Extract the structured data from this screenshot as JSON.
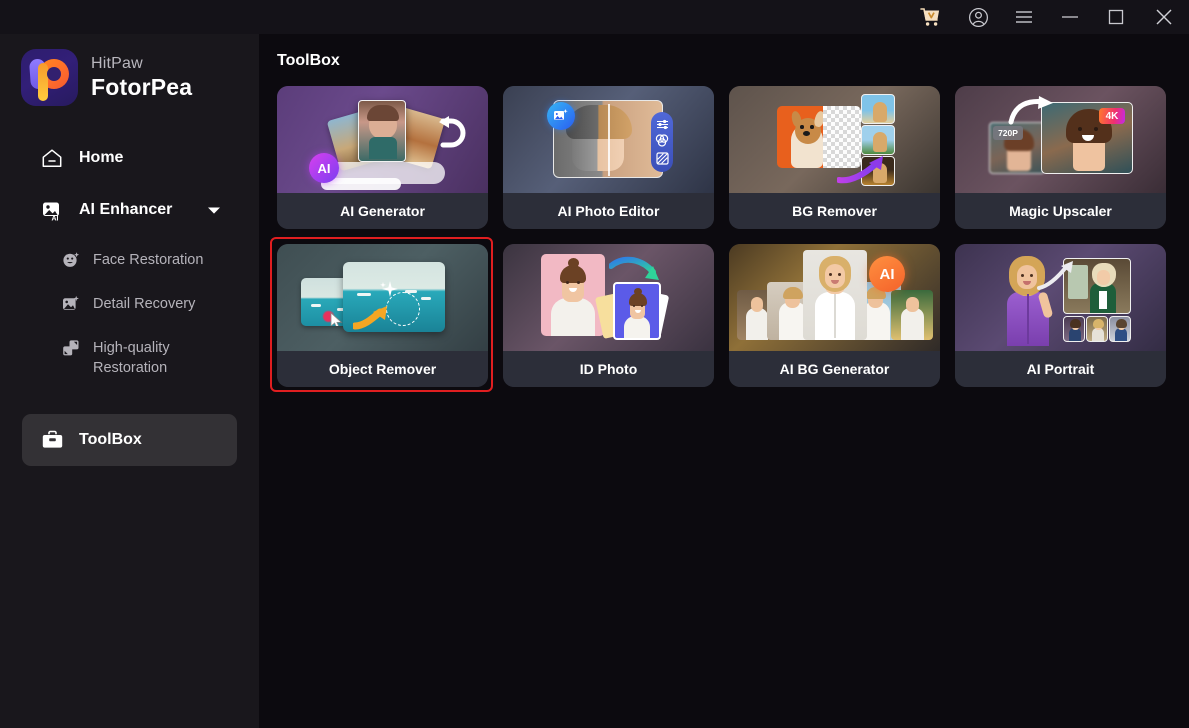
{
  "titlebar": {
    "buttons": [
      {
        "name": "cart-icon",
        "label": "Cart"
      },
      {
        "name": "account-icon",
        "label": "Account"
      },
      {
        "name": "menu-icon",
        "label": "Menu"
      },
      {
        "name": "minimize-icon",
        "label": "Minimize"
      },
      {
        "name": "maximize-icon",
        "label": "Maximize"
      },
      {
        "name": "close-icon",
        "label": "Close"
      }
    ]
  },
  "sidebar": {
    "brand": {
      "top": "HitPaw",
      "bottom": "FotorPea",
      "logo_icon": "hitpaw-logo-icon"
    },
    "home": {
      "label": "Home",
      "icon": "home-icon"
    },
    "enhancer": {
      "label": "AI Enhancer",
      "icon": "ai-enhancer-icon",
      "caret": "chevron-down-icon"
    },
    "sub_items": [
      {
        "label": "Face Restoration",
        "icon": "face-restoration-icon"
      },
      {
        "label": "Detail Recovery",
        "icon": "detail-recovery-icon"
      },
      {
        "label": "High-quality Restoration",
        "icon": "high-quality-restoration-icon"
      }
    ],
    "toolbox": {
      "label": "ToolBox",
      "icon": "toolbox-icon",
      "active": true
    }
  },
  "main": {
    "title": "ToolBox",
    "cards": [
      {
        "label": "AI Generator",
        "art": "art-aigen",
        "badge": "AI",
        "selected": false
      },
      {
        "label": "AI Photo Editor",
        "art": "art-photoeditor",
        "badge": "",
        "selected": false
      },
      {
        "label": "BG Remover",
        "art": "art-bgremover",
        "badge": "",
        "selected": false
      },
      {
        "label": "Magic Upscaler",
        "art": "art-upscaler",
        "badge": "",
        "selected": false,
        "chips": [
          "720P",
          "4K"
        ]
      },
      {
        "label": "Object Remover",
        "art": "art-objremover",
        "badge": "",
        "selected": true
      },
      {
        "label": "ID Photo",
        "art": "art-idphoto",
        "badge": "",
        "selected": false
      },
      {
        "label": "AI BG Generator",
        "art": "art-aibg",
        "badge": "AI",
        "selected": false
      },
      {
        "label": "AI Portrait",
        "art": "art-portrait",
        "badge": "",
        "selected": false
      }
    ]
  },
  "colors": {
    "selection_red": "#e01e20",
    "sidebar_bg": "#19171c",
    "main_bg": "#0c0a0f",
    "titlebar_bg": "#141218",
    "card_label_bg": "#2c2e39",
    "active_nav_bg": "#333135",
    "chip_4k": "#f0406a",
    "chip_720p": "#6a6a72"
  }
}
